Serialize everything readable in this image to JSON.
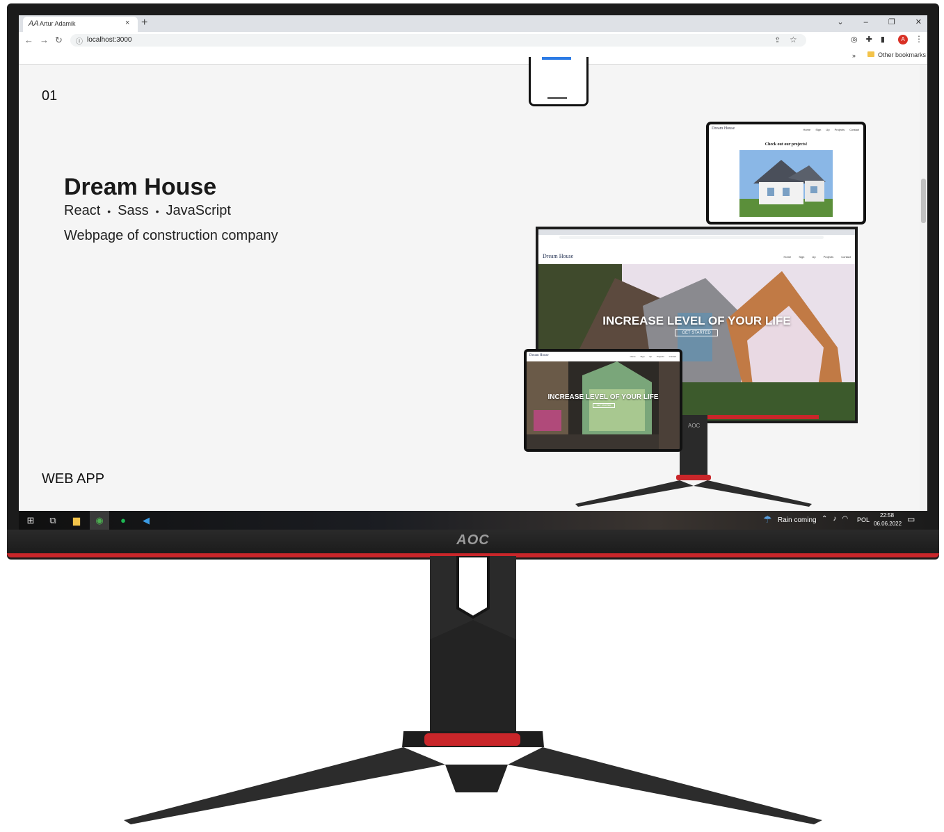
{
  "browser": {
    "tab_title": "Artur Adamik",
    "tab_favicon": "AA",
    "url": "localhost:3000",
    "bookmarks_label": "Other bookmarks",
    "profile_initial": "A",
    "new_tab_glyph": "+",
    "close_tab_glyph": "×",
    "window_controls": [
      "⌄",
      "–",
      "❐",
      "✕"
    ]
  },
  "page": {
    "project_number": "01",
    "project_title": "Dream House",
    "tech": [
      "React",
      "Sass",
      "JavaScript"
    ],
    "description": "Webpage of construction company",
    "category": "WEB APP"
  },
  "mockups": {
    "tablet_logo": "Dream House",
    "tablet_nav": "Home Sign Up Projects Contact",
    "tablet_heading": "Check out our projects!",
    "desktop_logo": "Dream House",
    "desktop_nav": "Home Sign Up Projects Contact",
    "hero_headline": "INCREASE LEVEL OF YOUR LIFE",
    "hero_cta": "GET STARTED",
    "monitor_brand": "AOC"
  },
  "taskbar": {
    "weather_text": "Rain coming",
    "language": "POL",
    "time": "22:58",
    "date": "06.06.2022"
  },
  "monitor": {
    "brand": "AOC",
    "accent_color": "#c9262a"
  }
}
